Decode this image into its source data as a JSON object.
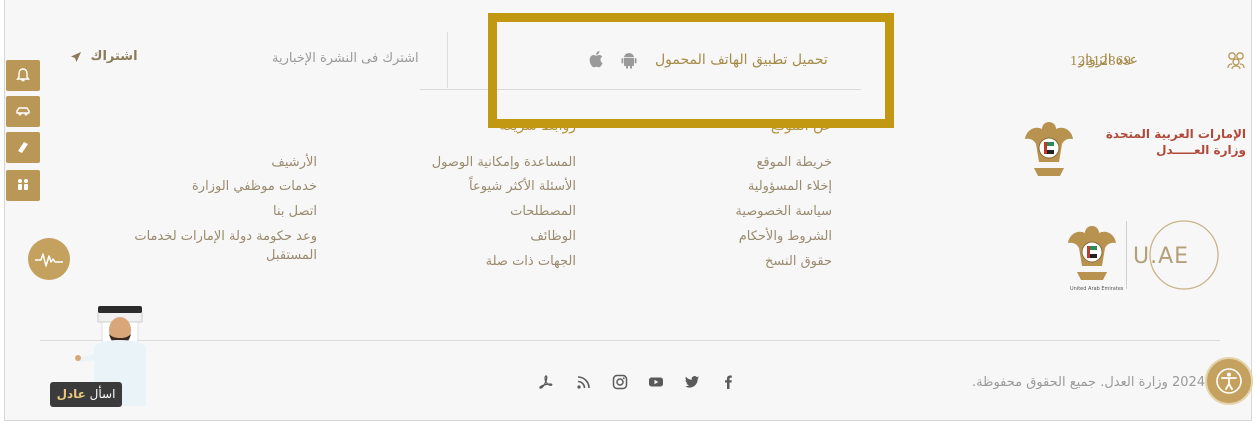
{
  "header": {
    "visitors_label": "عدد الزوار",
    "visitors_count": "12212869",
    "app_label": "تحميل تطبيق الهاتف المحمول",
    "newsletter_label": "اشترك فى النشرة الإخبارية",
    "subscribe_label": "اشتراك"
  },
  "footer_columns": {
    "col1_heading": "عن الموقع",
    "col1_links": [
      "خريطة الموقع",
      "إخلاء المسؤولية",
      "سياسة الخصوصية",
      "الشروط والأحكام",
      "حقوق النسخ"
    ],
    "col2_heading": "روابط سريعة",
    "col2_links": [
      "المساعدة وإمكانية الوصول",
      "الأسئلة الأكثر شيوعاً",
      "المصطلحات",
      "الوظائف",
      "الجهات ذات صلة"
    ],
    "col3_links": [
      "الأرشيف",
      "خدمات موظفي الوزارة",
      "اتصل بنا",
      "وعد حكومة دولة الإمارات لخدمات",
      "المستقبل"
    ]
  },
  "branding": {
    "ministry_line1": "الإمارات العربية المتحدة",
    "ministry_line2": "وزارة العـــــدل",
    "uae_logo_text": "U.AE",
    "emblem_caption": "United Arab Emirates"
  },
  "bottom": {
    "copyright": "2024 وزارة العدل. جميع الحقوق محفوظة."
  },
  "assistant": {
    "ask_prefix": "اسأل",
    "ask_name": "عادل"
  },
  "colors": {
    "accent_gold": "#b89757",
    "highlight_box": "#c29812",
    "ministry_red": "#b04a3a"
  },
  "icons": {
    "side_tabs": [
      "bell-icon",
      "car-icon",
      "book-icon",
      "family-icon"
    ],
    "social": [
      "facebook-icon",
      "twitter-icon",
      "youtube-icon",
      "instagram-icon",
      "rss-icon",
      "acrobat-icon"
    ]
  }
}
